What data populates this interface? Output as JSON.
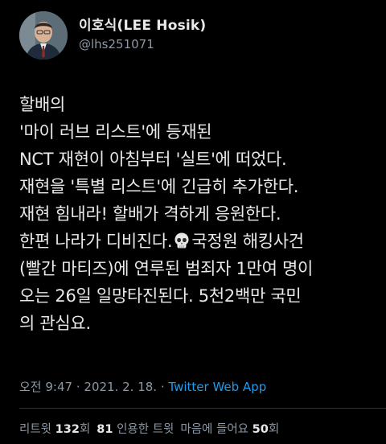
{
  "author": {
    "display_name": "이호식(LEE Hosik)",
    "handle": "@lhs251071"
  },
  "tweet": {
    "lines": [
      "할배의",
      "'마이 러브 리스트'에 등재된",
      "NCT 재현이 아침부터 '실트'에 떠었다.",
      "재현을 '특별 리스트'에 긴급히 추가한다.",
      "재현 힘내라! 할배가 격하게 응원한다.",
      "한편 나라가 디비진다.",
      "국정원 해킹사건",
      "(빨간 마티즈)에 연루된 범죄자 1만여 명이",
      "오는 26일 일망타진된다. 5천2백만 국민",
      "의 관심요."
    ],
    "emoji_icon": "skull-icon"
  },
  "meta": {
    "time": "오전 9:47",
    "sep1": "·",
    "date": "2021. 2. 18.",
    "sep2": "·",
    "source": "Twitter Web App"
  },
  "stats": {
    "retweets_label": "리트윗",
    "retweets_count": "132",
    "retweets_unit": "회",
    "quotes_count": "81",
    "quotes_label": "인용한 트윗",
    "likes_label": "마음에 들어요",
    "likes_count": "50",
    "likes_unit": "회"
  },
  "colors": {
    "background": "#000000",
    "text": "#e7e9ea",
    "secondary": "#8b98a5",
    "link": "#1d9bf0"
  }
}
